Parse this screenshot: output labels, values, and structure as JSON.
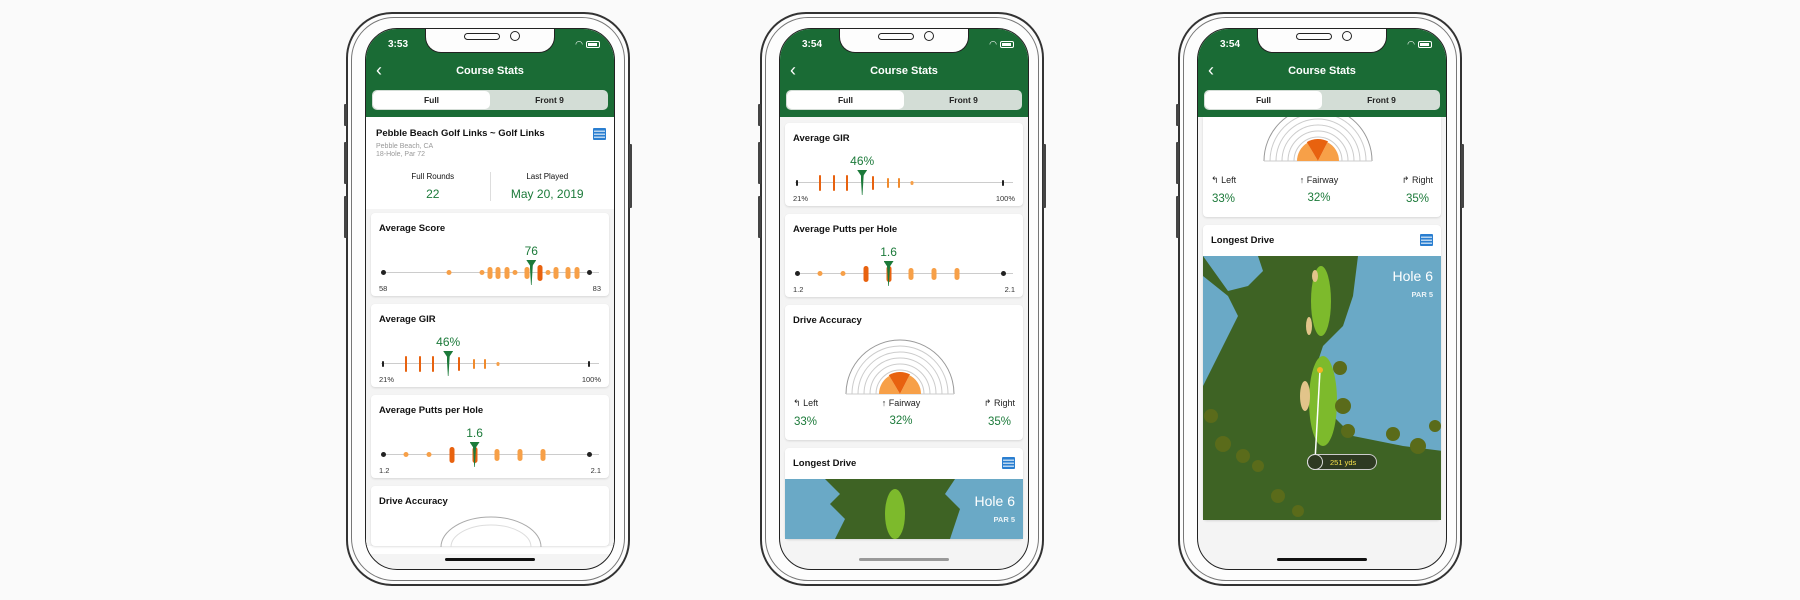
{
  "app": {
    "nav_title": "Course Stats",
    "back_icon": "chevron-left-icon",
    "segments": [
      "Full",
      "Front 9"
    ],
    "selected_segment": "Full",
    "colors": {
      "header": "#1a6b35",
      "accent": "#1c7a3a",
      "orange_dark": "#e8620f",
      "orange_light": "#f7a048",
      "calendar": "#2a7ed0"
    }
  },
  "screens": [
    {
      "status_time": "3:53",
      "course": {
        "name": "Pebble Beach Golf Links ~ Golf Links",
        "location": "Pebble Beach, CA",
        "details": "18-Hole, Par 72",
        "full_rounds_label": "Full Rounds",
        "full_rounds_value": "22",
        "last_played_label": "Last Played",
        "last_played_value": "May 20, 2019"
      },
      "average_score": {
        "title": "Average Score",
        "value": "76",
        "min": "58",
        "max": "83",
        "value_num": 76,
        "min_num": 58,
        "max_num": 83
      },
      "average_gir": {
        "title": "Average GIR",
        "value": "46%",
        "min": "21%",
        "max": "100%"
      },
      "average_putts": {
        "title": "Average Putts per Hole",
        "value": "1.6",
        "min": "1.2",
        "max": "2.1"
      },
      "drive_accuracy": {
        "title": "Drive Accuracy"
      }
    },
    {
      "status_time": "3:54",
      "average_gir": {
        "title": "Average GIR",
        "value": "46%",
        "min": "21%",
        "max": "100%"
      },
      "average_putts": {
        "title": "Average Putts per Hole",
        "value": "1.6",
        "min": "1.2",
        "max": "2.1"
      },
      "drive_accuracy": {
        "title": "Drive Accuracy",
        "left_label": "Left",
        "left_value": "33%",
        "fairway_label": "Fairway",
        "fairway_value": "32%",
        "right_label": "Right",
        "right_value": "35%"
      },
      "longest_drive": {
        "title": "Longest Drive",
        "hole": "Hole 6",
        "par": "PAR 5"
      }
    },
    {
      "status_time": "3:54",
      "drive_accuracy": {
        "left_label": "Left",
        "left_value": "33%",
        "fairway_label": "Fairway",
        "fairway_value": "32%",
        "right_label": "Right",
        "right_value": "35%"
      },
      "longest_drive": {
        "title": "Longest Drive",
        "hole": "Hole 6",
        "par": "PAR 5",
        "distance": "251 yds"
      }
    }
  ],
  "chart_data": [
    {
      "type": "scatter",
      "title": "Average Score",
      "xlim": [
        58,
        83
      ],
      "average": 76,
      "points": [
        {
          "x": 66,
          "kind": "dot"
        },
        {
          "x": 70,
          "kind": "dot"
        },
        {
          "x": 71,
          "kind": "bar"
        },
        {
          "x": 72,
          "kind": "bar"
        },
        {
          "x": 73,
          "kind": "bar"
        },
        {
          "x": 74,
          "kind": "dot"
        },
        {
          "x": 75.5,
          "kind": "bar"
        },
        {
          "x": 77,
          "kind": "bar-dark"
        },
        {
          "x": 78,
          "kind": "dot"
        },
        {
          "x": 79,
          "kind": "bar"
        },
        {
          "x": 80.5,
          "kind": "bar"
        },
        {
          "x": 81.5,
          "kind": "bar"
        }
      ]
    },
    {
      "type": "scatter",
      "title": "Average GIR",
      "xlim": [
        21,
        100
      ],
      "average": 46,
      "points": [
        {
          "x": 30,
          "kind": "tick-dark"
        },
        {
          "x": 35,
          "kind": "tick-dark"
        },
        {
          "x": 40,
          "kind": "tick-dark"
        },
        {
          "x": 50,
          "kind": "tick"
        },
        {
          "x": 56,
          "kind": "tick-small"
        },
        {
          "x": 60,
          "kind": "tick-small"
        },
        {
          "x": 65,
          "kind": "dot-small"
        }
      ]
    },
    {
      "type": "scatter",
      "title": "Average Putts per Hole",
      "xlim": [
        1.2,
        2.1
      ],
      "average": 1.6,
      "points": [
        {
          "x": 1.3,
          "kind": "dot"
        },
        {
          "x": 1.4,
          "kind": "dot"
        },
        {
          "x": 1.5,
          "kind": "bar-dark"
        },
        {
          "x": 1.6,
          "kind": "bar-dark"
        },
        {
          "x": 1.7,
          "kind": "bar"
        },
        {
          "x": 1.8,
          "kind": "bar"
        },
        {
          "x": 1.9,
          "kind": "bar"
        }
      ]
    },
    {
      "type": "pie",
      "title": "Drive Accuracy",
      "labels": [
        "Left",
        "Fairway",
        "Right"
      ],
      "values": [
        33,
        32,
        35
      ]
    }
  ]
}
